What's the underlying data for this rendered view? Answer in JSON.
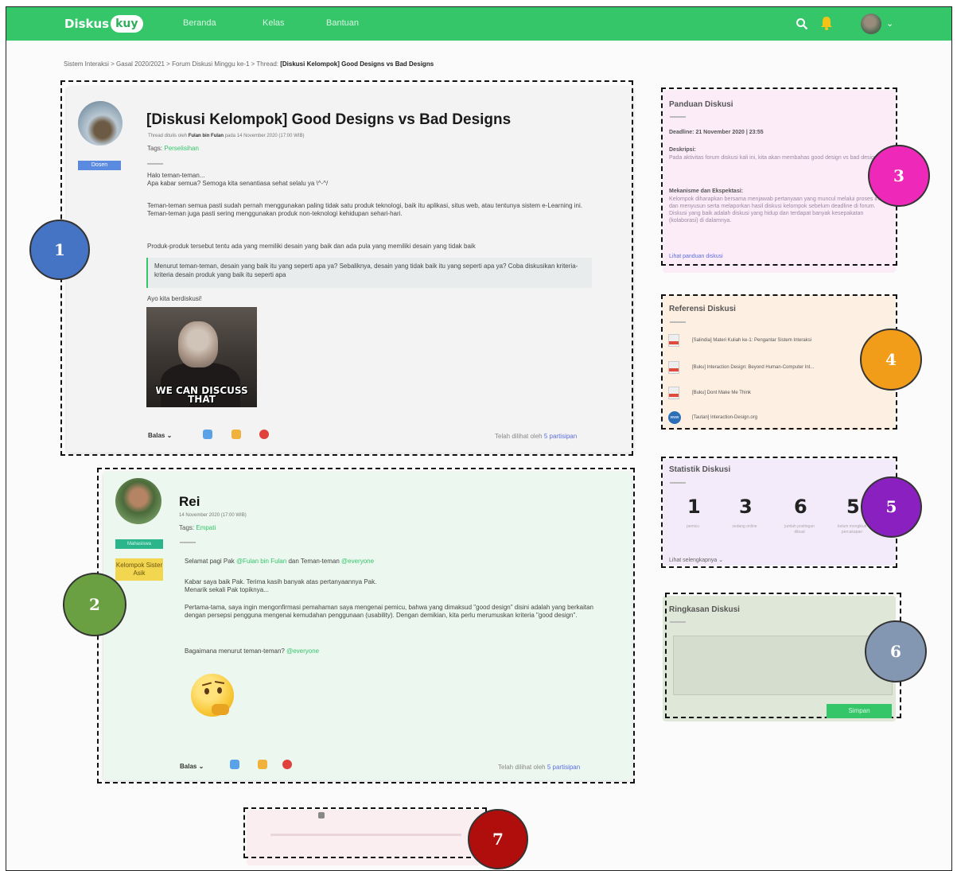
{
  "navbar": {
    "logo_text": "Diskus",
    "logo_pill": "kuy",
    "links": [
      "Beranda",
      "Kelas",
      "Bantuan"
    ],
    "icons": [
      "search-icon",
      "bell-icon",
      "avatar",
      "chevron-down-icon"
    ],
    "colors": {
      "primary": "#35c66a"
    }
  },
  "breadcrumb": {
    "path": "Sistem Interaksi > Gasal 2020/2021 > Forum Diskusi Minggu ke-1 > Thread:",
    "current": "[Diskusi Kelompok] Good Designs vs Bad Designs"
  },
  "thread": {
    "title": "[Diskusi Kelompok] Good Designs vs Bad Designs",
    "meta_prefix": "Thread ditulis oleh",
    "author": "Fulan bin Fulan",
    "meta_suffix": "pada 14 November 2020 (17:00 WIB)",
    "tags_label": "Tags:",
    "tag": "Perselisihan",
    "role_badge": "Dosen",
    "body": [
      "Halo teman-teman...",
      "Apa kabar semua? Semoga kita senantiasa sehat selalu ya \\^-^/",
      "Teman-teman semua pasti sudah pernah menggunakan paling tidak satu produk teknologi, baik itu aplikasi, situs web, atau tentunya sistem e-Learning ini. Teman-teman juga pasti sering menggunakan produk non-teknologi kehidupan sehari-hari.",
      "Produk-produk tersebut tentu ada yang memiliki desain yang baik dan ada pula yang memiliki desain yang tidak baik"
    ],
    "quote": "Menurut teman-teman, desain yang baik itu yang seperti apa ya? Sebaliknya, desain yang tidak baik itu yang seperti apa ya? Coba diskusikan kriteria-kriteria desain produk yang baik itu seperti apa",
    "closing": "Ayo kita berdiskusi!",
    "gif_caption": "WE CAN DISCUSS THAT",
    "reply_label": "Balas",
    "seen_prefix": "Telah dilihat oleh",
    "seen_link": "5 partisipan"
  },
  "reply": {
    "name": "Rei",
    "date": "14 November 2020 (17:00 WIB)",
    "tags_label": "Tags:",
    "tag": "Empati",
    "role_badge": "Mahasiswa",
    "group_badge": "Kelompok Sister Asik",
    "greeting_prefix": "Selamat pagi Pak",
    "greeting_mention1": "@Fulan bin Fulan",
    "greeting_middle": "dan Teman-teman",
    "greeting_mention2": "@everyone",
    "para1": "Kabar saya baik Pak. Terima kasih banyak atas pertanyaannya Pak.",
    "para1b": "Menarik sekali Pak topiknya...",
    "para2": "Pertama-tama, saya ingin mengonfirmasi pemahaman saya mengenai pemicu, bahwa yang dimaksud \"good design\" disini adalah yang berkaitan dengan persepsi pengguna mengenai kemudahan penggunaan (usability). Dengan demikian, kita perlu merumuskan kriteria \"good design\".",
    "para3_prefix": "Bagaimana menurut teman-teman?",
    "para3_mention": "@everyone",
    "reply_label": "Balas",
    "seen_prefix": "Telah dilihat oleh",
    "seen_link": "5 partisipan"
  },
  "guide": {
    "title": "Panduan Diskusi",
    "deadline": "Deadline: 21 November 2020 | 23:55",
    "desc_label": "Deskripsi:",
    "desc": "Pada aktivitas forum diskusi kali ini, kita akan membahas good design vs bad design.",
    "mech_label": "Mekanisme dan Ekspektasi:",
    "mech": "Kelompok diharapkan bersama menjawab pertanyaan yang muncul melalui proses inquiry dan menyusun serta melaporkan hasil diskusi kelompok sebelum deadline di forum. Diskusi yang baik adalah diskusi yang hidup dan terdapat banyak kesepakatan (kolaborasi) di dalamnya.",
    "link": "Lihat panduan diskusi"
  },
  "references": {
    "title": "Referensi Diskusi",
    "items": [
      {
        "icon": "pdf-icon",
        "label": "[Salindia] Materi Kuliah ke-1: Pengantar Sistem Interaksi"
      },
      {
        "icon": "pdf-icon",
        "label": "[Buku] Interaction Design: Beyond Human-Computer Int..."
      },
      {
        "icon": "pdf-icon",
        "label": "[Buku] Dont Make Me Think"
      },
      {
        "icon": "globe-icon",
        "label": "[Tautan] Interaction-Design.org"
      }
    ]
  },
  "stats": {
    "title": "Statistik Diskusi",
    "items": [
      {
        "value": "1",
        "label": "pemicu"
      },
      {
        "value": "3",
        "label": "sedang online"
      },
      {
        "value": "6",
        "label": "jumlah postingan dibuat"
      },
      {
        "value": "5",
        "label": "belum mengikuti percakapan"
      }
    ],
    "more": "Lihat selengkapnya"
  },
  "summary": {
    "title": "Ringkasan Diskusi",
    "save_label": "Simpan"
  },
  "annotations": [
    "1",
    "2",
    "3",
    "4",
    "5",
    "6",
    "7"
  ]
}
